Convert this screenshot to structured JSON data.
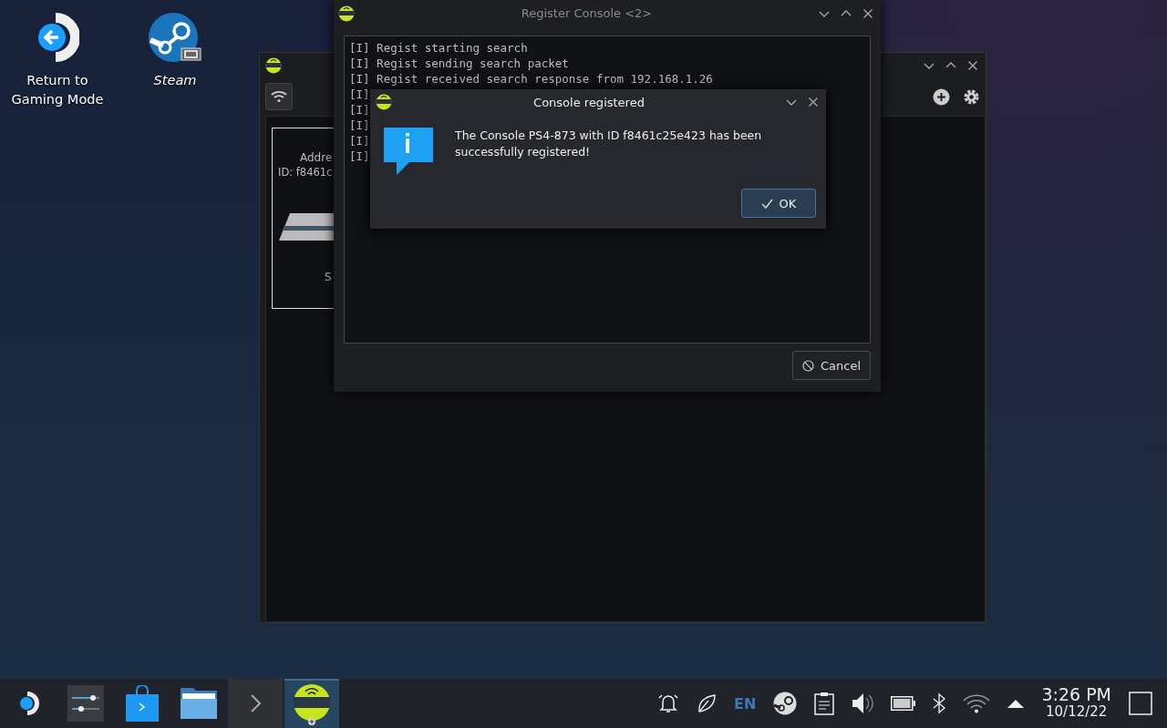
{
  "desktop_icons": [
    {
      "kind": "return",
      "label": "Return to Gaming Mode"
    },
    {
      "kind": "steam",
      "label": "Steam"
    }
  ],
  "background_window": {
    "card": {
      "address": "Addre",
      "id": "ID: f8461c",
      "status": "S"
    }
  },
  "register_window": {
    "title": "Register Console <2>",
    "log_lines": [
      "[I] Regist starting search",
      "[I] Regist sending search packet",
      "[I] Regist received search response from 192.168.1.26",
      "[I]",
      "[I]",
      "[I]",
      "[I]",
      "[I]"
    ],
    "cancel_label": "Cancel"
  },
  "dialog": {
    "title": "Console registered",
    "message": "The Console PS4-873 with ID f8461c25e423 has been successfully registered!",
    "ok_label": "OK"
  },
  "taskbar": {
    "apps": [
      {
        "kind": "launcher",
        "selected": false
      },
      {
        "kind": "settings",
        "selected": false
      },
      {
        "kind": "store",
        "selected": false
      },
      {
        "kind": "files",
        "selected": false
      },
      {
        "kind": "terminal",
        "selected": false
      },
      {
        "kind": "chiaki",
        "selected": true
      }
    ],
    "language": "EN",
    "time": "3:26 PM",
    "date": "10/12/22"
  }
}
